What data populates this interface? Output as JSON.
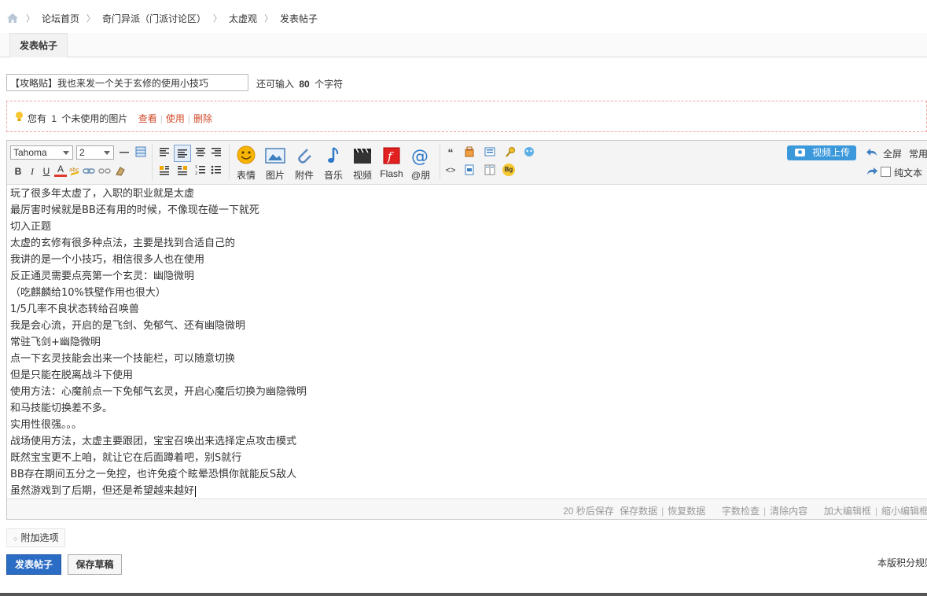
{
  "breadcrumb": {
    "items": [
      "论坛首页",
      "奇门异派（门派讨论区）",
      "太虚观",
      "发表帖子"
    ]
  },
  "tabs": {
    "active": "发表帖子"
  },
  "title_field": {
    "value": "【攻略贴】我也来发一个关于玄修的使用小技巧",
    "counter_prefix": "还可输入",
    "counter_value": "80",
    "counter_suffix": "个字符"
  },
  "notice": {
    "prefix": "您有",
    "count": "1",
    "suffix": "个未使用的图片",
    "links": [
      "查看",
      "使用",
      "删除"
    ]
  },
  "toolbar": {
    "font_family": "Tahoma",
    "font_size": "2",
    "big_buttons": [
      "表情",
      "图片",
      "附件",
      "音乐",
      "视频",
      "Flash",
      "@朋"
    ],
    "video_upload": "视频上传",
    "fullscreen": "全屏",
    "common": "常用",
    "plain_text": "纯文本",
    "icons": {
      "bold_label": "B",
      "italic_label": "I",
      "underline_label": "U",
      "font_color_label": "A",
      "quote_label": "“",
      "code_label": "<>",
      "bg_label": "Bg"
    }
  },
  "content_lines": [
    "玩了很多年太虚了，入职的职业就是太虚",
    "最厉害时候就是BB还有用的时候，不像现在碰一下就死",
    "切入正题",
    "太虚的玄修有很多种点法，主要是找到合适自己的",
    "我讲的是一个小技巧，相信很多人也在使用",
    "反正通灵需要点亮第一个玄灵：幽隐微明",
    "（吃麒麟给10%铁壁作用也很大）",
    "1/5几率不良状态转给召唤兽",
    "我是会心流，开启的是飞剑、免郁气、还有幽隐微明",
    "常驻飞剑+幽隐微明",
    "点一下玄灵技能会出来一个技能栏，可以随意切换",
    "但是只能在脱离战斗下使用",
    "使用方法：心魔前点一下免郁气玄灵，开启心魔后切换为幽隐微明",
    "和马技能切换差不多。",
    "实用性很强。。。",
    "战场使用方法，太虚主要跟团，宝宝召唤出来选择定点攻击模式",
    "既然宝宝更不上咱，就让它在后面蹲着吧，别S就行",
    "BB存在期间五分之一免控，也许免疫个眩晕恐惧你就能反S敌人",
    "虽然游戏到了后期，但还是希望越来越好"
  ],
  "statusbar": {
    "autosave": "20 秒后保存",
    "save_data": "保存数据",
    "restore_data": "恢复数据",
    "word_check": "字数检查",
    "clear": "清除内容",
    "enlarge": "加大编辑框",
    "shrink": "缩小编辑框"
  },
  "extra_options": "附加选项",
  "actions": {
    "submit": "发表帖子",
    "save_draft": "保存草稿"
  },
  "rules_text": "本版积分规则",
  "colors": {
    "primary_button": "#2b6cc4",
    "video_button": "#3a98db",
    "link_red": "#d14b2b",
    "notice_border": "#f2a6a6"
  }
}
